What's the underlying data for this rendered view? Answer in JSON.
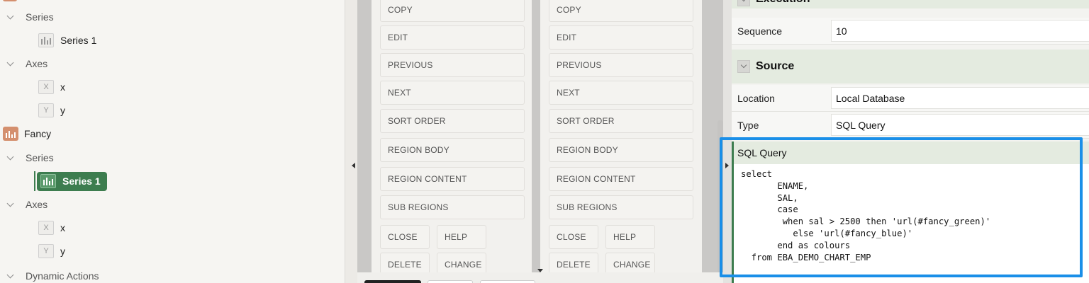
{
  "tree": {
    "items": [
      {
        "label": "Series",
        "kind": "folder"
      },
      {
        "label": "Series 1",
        "kind": "series"
      },
      {
        "label": "Axes",
        "kind": "folder"
      },
      {
        "label": "x",
        "kind": "axis-x"
      },
      {
        "label": "y",
        "kind": "axis-y"
      },
      {
        "label": "Fancy",
        "kind": "chart"
      },
      {
        "label": "Series",
        "kind": "folder"
      },
      {
        "label": "Series 1",
        "kind": "series-selected"
      },
      {
        "label": "Axes",
        "kind": "folder"
      },
      {
        "label": "x",
        "kind": "axis-x"
      },
      {
        "label": "y",
        "kind": "axis-y"
      },
      {
        "label": "Dynamic Actions",
        "kind": "folder"
      }
    ],
    "axis_x_glyph": "X",
    "axis_y_glyph": "Y"
  },
  "grid_left": {
    "positions": [
      "COPY",
      "EDIT",
      "PREVIOUS",
      "NEXT",
      "SORT ORDER",
      "REGION BODY",
      "REGION CONTENT",
      "SUB REGIONS",
      "CLOSE",
      "HELP",
      "DELETE",
      "CHANGE"
    ]
  },
  "grid_right": {
    "positions": [
      "COPY",
      "EDIT",
      "PREVIOUS",
      "NEXT",
      "SORT ORDER",
      "REGION BODY",
      "REGION CONTENT",
      "SUB REGIONS",
      "CLOSE",
      "HELP",
      "DELETE",
      "CHANGE"
    ]
  },
  "props": {
    "execution_title": "Execution",
    "sequence_label": "Sequence",
    "sequence_value": "10",
    "source_title": "Source",
    "location_label": "Location",
    "location_value": "Local Database",
    "type_label": "Type",
    "type_value": "SQL Query",
    "sql_label": "SQL Query",
    "sql_code": "select\n       ENAME,\n       SAL,\n       case\n        when sal > 2500 then 'url(#fancy_green)'\n          else 'url(#fancy_blue)'\n       end as colours\n  from EBA_DEMO_CHART_EMP"
  },
  "colors": {
    "selected_node": "#3d7d4f",
    "highlight_border": "#1a8fe8",
    "section_bg": "#e4ebe0"
  }
}
